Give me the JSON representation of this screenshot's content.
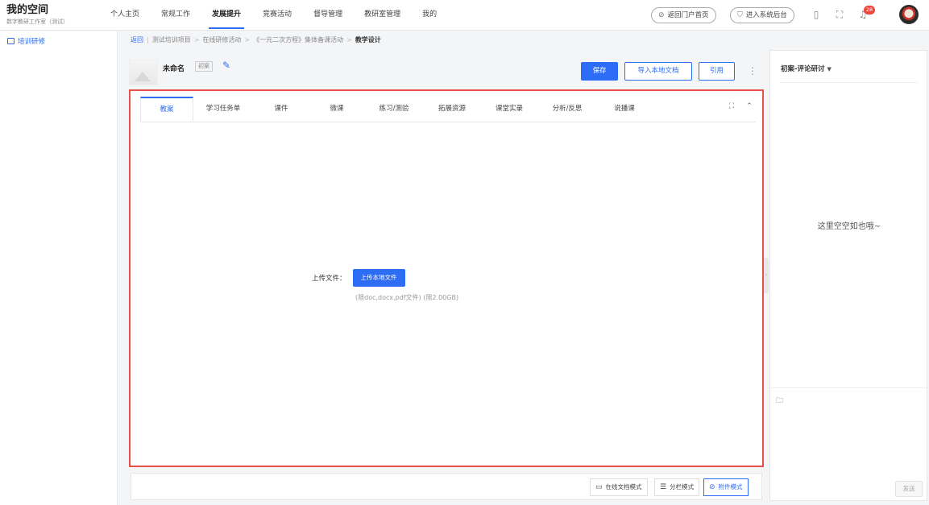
{
  "brand": {
    "title": "我的空间",
    "subtitle": "数字教研工作室（测试）"
  },
  "nav": [
    {
      "label": "个人主页",
      "active": false
    },
    {
      "label": "常规工作",
      "active": false
    },
    {
      "label": "发展提升",
      "active": true
    },
    {
      "label": "竞赛活动",
      "active": false
    },
    {
      "label": "督导管理",
      "active": false
    },
    {
      "label": "教研室管理",
      "active": false
    },
    {
      "label": "我的",
      "active": false
    }
  ],
  "header": {
    "portal_button": "返回门户首页",
    "admin_button": "进入系统后台",
    "notification_count": "28",
    "icons": [
      "return-icon",
      "shield-icon",
      "tablet-icon",
      "fullscreen-icon",
      "bell-icon"
    ]
  },
  "sidebar": {
    "items": [
      {
        "label": "培训研修",
        "icon": "training-icon"
      }
    ]
  },
  "breadcrumb": {
    "back": "返回",
    "items": [
      "测试培训项目",
      "在线研修活动",
      "《一元二次方程》集体备课活动"
    ],
    "current": "教学设计"
  },
  "document": {
    "name": "未命名",
    "tag": "初案"
  },
  "toolbar": {
    "save": "保存",
    "import": "导入本地文档",
    "cite": "引用"
  },
  "tabs": [
    "教案",
    "学习任务单",
    "课件",
    "微课",
    "练习/测验",
    "拓展资源",
    "课堂实录",
    "分析/反思",
    "说播课"
  ],
  "upload": {
    "label": "上传文件：",
    "button": "上传本地文件",
    "hint": "(限doc,docx,pdf文件)  (限2.00GB)"
  },
  "modes": [
    {
      "label": "在线文档模式",
      "icon": "monitor-icon",
      "active": false
    },
    {
      "label": "分栏模式",
      "icon": "columns-icon",
      "active": false
    },
    {
      "label": "附件模式",
      "icon": "paperclip-icon",
      "active": true
    }
  ],
  "comments": {
    "title": "初案-评论研讨",
    "empty": "这里空空如也哦~",
    "send": "发送"
  },
  "colors": {
    "accent": "#2d6cf4",
    "highlight": "#e8504a",
    "badge": "#f0453d"
  }
}
